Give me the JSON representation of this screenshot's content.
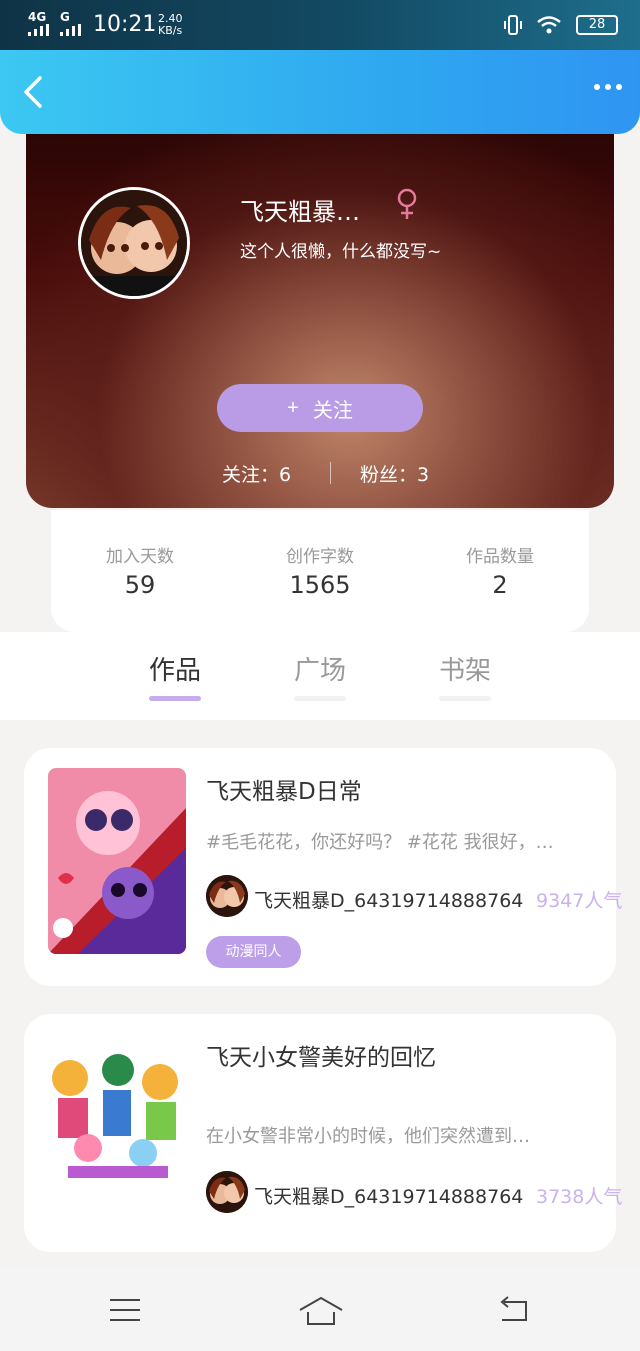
{
  "status_bar": {
    "signal_left": "4G",
    "signal_right": "G",
    "time": "10:21",
    "speed_value": "2.40",
    "speed_unit": "KB/s",
    "battery": "28"
  },
  "header": {
    "back_icon": "chevron-left-icon",
    "more_icon": "more-dots-icon"
  },
  "profile": {
    "name": "飞天粗暴…",
    "gender_icon": "female-icon",
    "bio": "这个人很懒，什么都没写~",
    "follow_button": "关注",
    "follow_plus": "+",
    "following_label": "关注：",
    "following_count": "6",
    "fans_label": "粉丝：",
    "fans_count": "3"
  },
  "stats": [
    {
      "label": "加入天数",
      "value": "59"
    },
    {
      "label": "创作字数",
      "value": "1565"
    },
    {
      "label": "作品数量",
      "value": "2"
    }
  ],
  "tabs": [
    {
      "label": "作品",
      "active": true
    },
    {
      "label": "广场",
      "active": false
    },
    {
      "label": "书架",
      "active": false
    }
  ],
  "works": [
    {
      "title": "飞天粗暴D日常",
      "desc": "#毛毛花花，你还好吗？ #花花 我很好，…",
      "author": "飞天粗暴D_64319714888764",
      "popularity": "9347人气",
      "tag": "动漫同人"
    },
    {
      "title": "飞天小女警美好的回忆",
      "desc": "在小女警非常小的时候，他们突然遭到…",
      "author": "飞天粗暴D_64319714888764",
      "popularity": "3738人气"
    }
  ],
  "colors": {
    "header_blue": "#2fa8f0",
    "accent_purple": "#b99be6",
    "popularity": "#c9b2ee"
  },
  "nav": {
    "menu_icon": "menu-icon",
    "home_icon": "home-icon",
    "back_icon": "back-icon"
  }
}
